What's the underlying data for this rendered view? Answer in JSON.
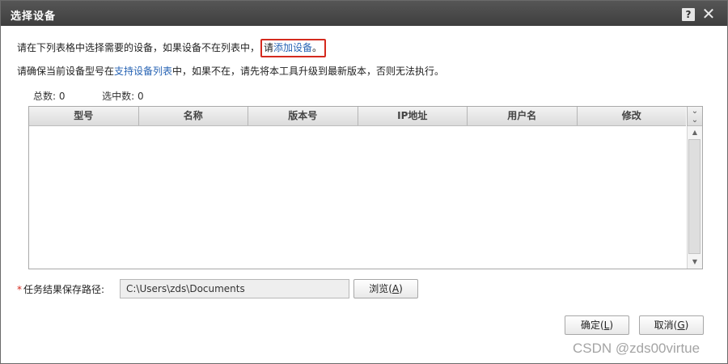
{
  "window": {
    "title": "选择设备",
    "help_icon": "question-icon",
    "close_icon": "close-icon"
  },
  "info": {
    "line1_text": "请在下列表格中选择需要的设备，如果设备不在列表中，",
    "line1_please": "请",
    "line1_link": "添加设备",
    "line1_end": "。",
    "line2_pre": "请确保当前设备型号在",
    "line2_link": "支持设备列表",
    "line2_post": "中，如果不在，请先将本工具升级到最新版本，否则无法执行。"
  },
  "counts": {
    "total_label": "总数:",
    "total_value": "0",
    "selected_label": "选中数:",
    "selected_value": "0"
  },
  "table": {
    "columns": [
      "型号",
      "名称",
      "版本号",
      "IP地址",
      "用户名",
      "修改"
    ],
    "rows": []
  },
  "path": {
    "required_mark": "*",
    "label": "任务结果保存路径:",
    "value": "C:\\Users\\zds\\Documents"
  },
  "buttons": {
    "browse_label": "浏览(",
    "browse_key": "A",
    "browse_end": ")",
    "ok_label": "确定(",
    "ok_key": "L",
    "ok_end": ")",
    "cancel_label": "取消(",
    "cancel_key": "G",
    "cancel_end": ")"
  },
  "watermark": "CSDN @zds00virtue",
  "colors": {
    "titlebar": "#4a4a4a",
    "link": "#2864b4",
    "highlight_border": "#d42a1e"
  }
}
